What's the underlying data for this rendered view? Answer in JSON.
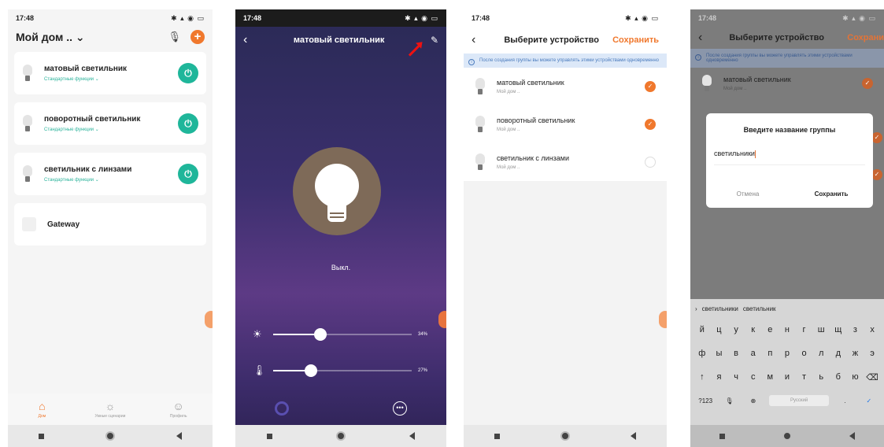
{
  "phone1": {
    "status_time": "17:48",
    "title": "Мой дом .. ⌄",
    "devices": [
      {
        "name": "матовый светильник",
        "sub": "Стандартные функции ⌄"
      },
      {
        "name": "поворотный светильник",
        "sub": "Стандартные функции ⌄"
      },
      {
        "name": "светильник с линзами",
        "sub": "Стандартные функции ⌄"
      }
    ],
    "gateway": "Gateway",
    "tabs": [
      "Дом",
      "Умные сценарии",
      "Профиль"
    ]
  },
  "phone2": {
    "status_time": "17:48",
    "title": "матовый светильник",
    "state": "Выкл.",
    "brightness": 34,
    "brightness_label": "34%",
    "temperature": 27,
    "temperature_label": "27%"
  },
  "phone3": {
    "status_time": "17:48",
    "title": "Выберите устройство",
    "save": "Сохранить",
    "info": "После создания группы вы можете управлять этими устройствами одновременно",
    "devices": [
      {
        "name": "матовый светильник",
        "home": "Мой дом ..",
        "checked": true
      },
      {
        "name": "поворотный светильник",
        "home": "Мой дом ..",
        "checked": true
      },
      {
        "name": "светильник с линзами",
        "home": "Мой дом ..",
        "checked": false
      }
    ]
  },
  "phone4": {
    "status_time": "17:48",
    "title": "Выберите устройство",
    "save": "Сохрани",
    "info": "После создания группы вы можете управлять этими устройствами одновременно",
    "device_name": "матовый светильник",
    "device_home": "Мой дом ..",
    "dialog": {
      "title": "Введите название группы",
      "value": "светильники",
      "cancel": "Отмена",
      "save": "Сохранить"
    },
    "suggestions": [
      "светильники",
      "светильник"
    ],
    "keyboard": {
      "row1": [
        "й",
        "ц",
        "у",
        "к",
        "е",
        "н",
        "г",
        "ш",
        "щ",
        "з",
        "х"
      ],
      "row2": [
        "ф",
        "ы",
        "в",
        "а",
        "п",
        "р",
        "о",
        "л",
        "д",
        "ж",
        "э"
      ],
      "row3": [
        "↑",
        "я",
        "ч",
        "с",
        "м",
        "и",
        "т",
        "ь",
        "б",
        "ю",
        "⌫"
      ],
      "row4_left": "?123",
      "space": "Русский"
    }
  },
  "colors": {
    "accent": "#f0782d",
    "power": "#1fb69a",
    "info_bg": "#dce8f8"
  }
}
